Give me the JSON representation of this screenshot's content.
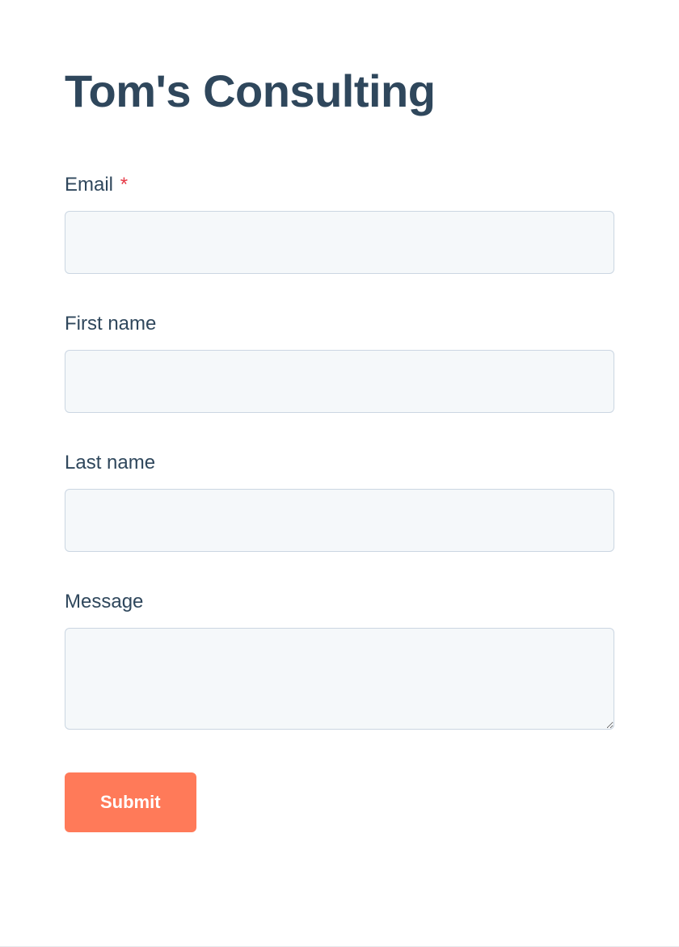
{
  "header": {
    "title": "Tom's Consulting"
  },
  "form": {
    "fields": {
      "email": {
        "label": "Email",
        "required": true,
        "value": ""
      },
      "firstName": {
        "label": "First name",
        "required": false,
        "value": ""
      },
      "lastName": {
        "label": "Last name",
        "required": false,
        "value": ""
      },
      "message": {
        "label": "Message",
        "required": false,
        "value": ""
      }
    },
    "requiredMarker": "*",
    "submitLabel": "Submit"
  }
}
